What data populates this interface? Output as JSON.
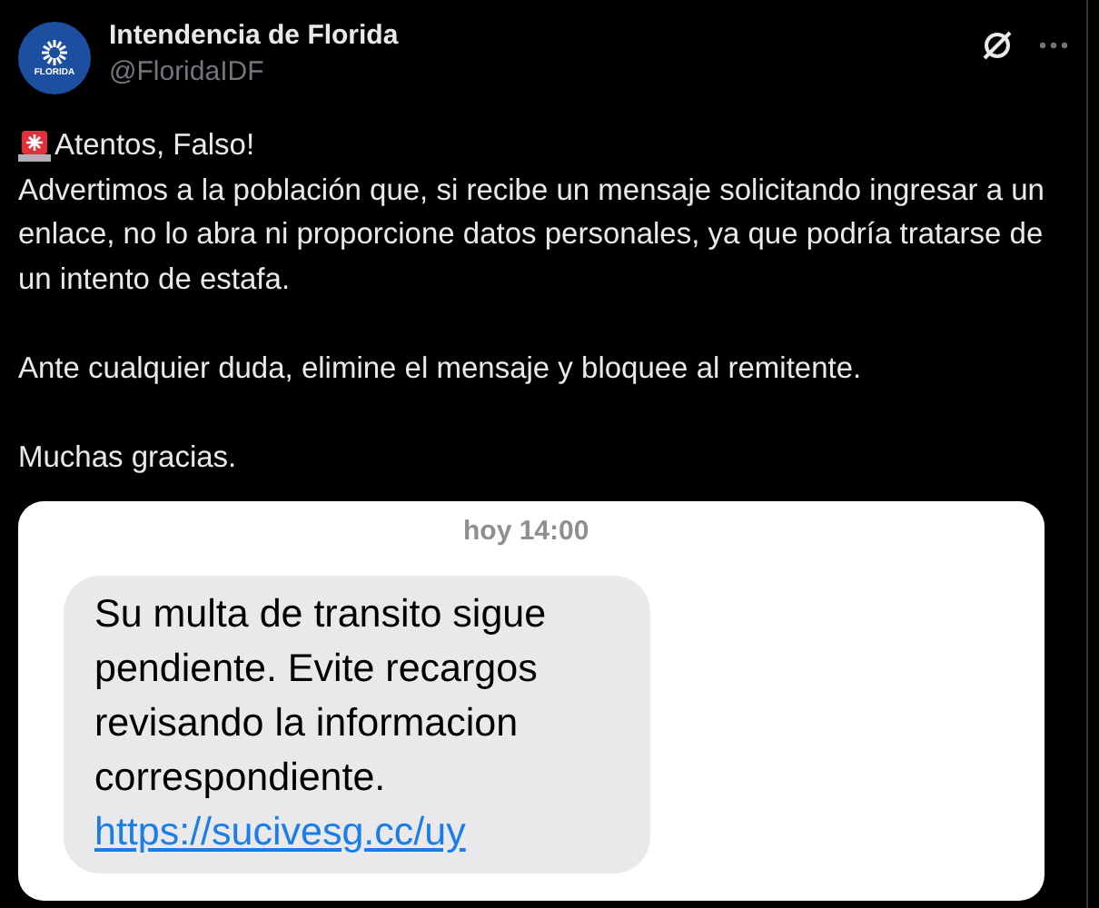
{
  "author": {
    "name": "Intendencia de Florida",
    "handle": "@FloridaIDF",
    "avatar_text": "FLORIDA"
  },
  "post": {
    "headline": "Atentos, Falso!",
    "paragraphs": [
      "Advertimos a la población que, si recibe un mensaje solicitando ingresar a un enlace, no lo abra ni proporcione datos personales, ya que podría tratarse de un intento de estafa.",
      "Ante cualquier duda, elimine el mensaje y bloquee al remitente.",
      "Muchas gracias."
    ]
  },
  "sms": {
    "timestamp": "hoy 14:00",
    "message": "Su multa de transito sigue pendiente. Evite recargos revisando la informacion correspondiente.",
    "link": "https://sucivesg.cc/uy"
  }
}
